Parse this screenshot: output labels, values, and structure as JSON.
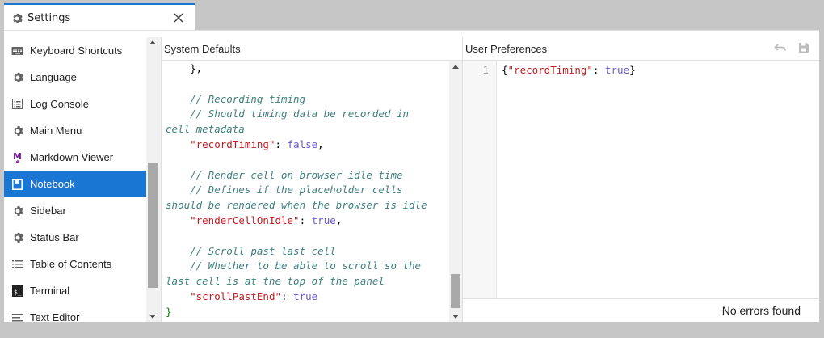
{
  "tab": {
    "title": "Settings",
    "icon": "gear-icon",
    "close_icon": "close-icon"
  },
  "sidebar": {
    "items": [
      {
        "label": "Keyboard Shortcuts",
        "icon": "keyboard-icon"
      },
      {
        "label": "Language",
        "icon": "gear-icon"
      },
      {
        "label": "Log Console",
        "icon": "list-icon"
      },
      {
        "label": "Main Menu",
        "icon": "gear-icon"
      },
      {
        "label": "Markdown Viewer",
        "icon": "markdown-icon"
      },
      {
        "label": "Notebook",
        "icon": "notebook-icon",
        "active": true
      },
      {
        "label": "Sidebar",
        "icon": "gear-icon"
      },
      {
        "label": "Status Bar",
        "icon": "gear-icon"
      },
      {
        "label": "Table of Contents",
        "icon": "toc-icon"
      },
      {
        "label": "Terminal",
        "icon": "terminal-icon"
      },
      {
        "label": "Text Editor",
        "icon": "text-editor-icon"
      }
    ]
  },
  "system_defaults": {
    "title": "System Defaults",
    "lines": [
      "    },",
      "",
      "    // Recording timing",
      "    // Should timing data be recorded in",
      "cell metadata",
      "    \"recordTiming\": false,",
      "",
      "    // Render cell on browser idle time",
      "    // Defines if the placeholder cells",
      "should be rendered when the browser is idle",
      "    \"renderCellOnIdle\": true,",
      "",
      "    // Scroll past last cell",
      "    // Whether to be able to scroll so the",
      "last cell is at the top of the panel",
      "    \"scrollPastEnd\": true",
      "}"
    ]
  },
  "user_preferences": {
    "title": "User Preferences",
    "undo_icon": "undo-icon",
    "save_icon": "save-icon",
    "line_number": "1",
    "content": "{\"recordTiming\": true}",
    "status": "No errors found"
  },
  "colors": {
    "accent": "#1976d2",
    "comment": "#408080",
    "string_key": "#ba2121",
    "keyword": "#6a5acd"
  }
}
